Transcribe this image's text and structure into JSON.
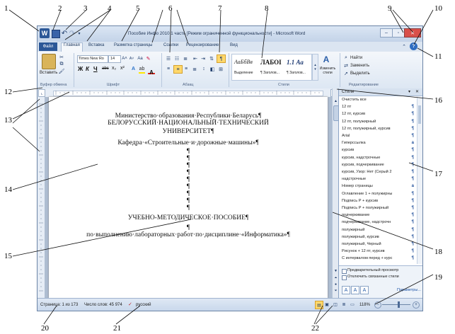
{
  "callouts": [
    "1",
    "2",
    "3",
    "4",
    "5",
    "6",
    "7",
    "8",
    "9",
    "10",
    "11",
    "12",
    "13",
    "14",
    "15",
    "16",
    "17",
    "18",
    "19",
    "20",
    "21",
    "22"
  ],
  "window": {
    "title": "Пособие Инфо 2010 1 часть [Режим ограниченной функциональности] - Microsoft Word"
  },
  "tabs": {
    "file": "Файл",
    "home": "Главная",
    "insert": "Вставка",
    "layout": "Разметка страницы",
    "refs": "Ссылки",
    "review": "Рецензирование",
    "view": "Вид"
  },
  "ribbon": {
    "paste": "Вставить",
    "font_name": "Times New Ro",
    "font_size": "14",
    "bold": "Ж",
    "italic": "К",
    "underline": "Ч",
    "strike": "abc",
    "sub": "x₂",
    "sup": "x²",
    "aa": "Aa",
    "font_color": "A",
    "style_samples": [
      {
        "sample": "АаБбВв",
        "label": "Выделение"
      },
      {
        "sample": "ЛАБОІ",
        "label": "¶ Заголов..."
      },
      {
        "sample": "1.1 Аа",
        "label": "¶ Заголов..."
      }
    ],
    "change_styles": "Изменить стили",
    "find": "Найти",
    "replace": "Заменить",
    "select": "Выделить",
    "groups": {
      "clipboard": "Буфер обмена",
      "font": "Шрифт",
      "paragraph": "Абзац",
      "styles": "Стили",
      "editing": "Редактирование"
    }
  },
  "document": {
    "lines": [
      "Министерство·образования·Республики·Беларусь¶",
      "БЕЛОРУССКИЙ·НАЦИОНАЛЬНЫЙ·ТЕХНИЧЕСКИЙ",
      "УНИВЕРСИТЕТ¶",
      "Кафедра·«Строительные·и·дорожные·машины»¶",
      "¶",
      "¶",
      "¶",
      "¶",
      "¶",
      "¶",
      "¶",
      "¶",
      "¶",
      "УЧЕБНО-МЕТОДИЧЕСКОЕ·ПОСОБИЕ¶",
      "¶",
      "по·выполнению·лабораторных·работ·по·дисциплине·«Информатика»¶"
    ]
  },
  "styles_pane": {
    "title": "Стили",
    "items": [
      {
        "label": "Очистить все",
        "mark": ""
      },
      {
        "label": "12 пт",
        "mark": "¶"
      },
      {
        "label": "12 пт, курсив",
        "mark": "¶"
      },
      {
        "label": "12 пт, полужирный",
        "mark": "¶"
      },
      {
        "label": "12 пт, полужирный, курсив",
        "mark": "¶"
      },
      {
        "label": "Arial",
        "mark": "¶"
      },
      {
        "label": "Гиперссылка",
        "mark": "a"
      },
      {
        "label": "курсив",
        "mark": "¶"
      },
      {
        "label": "курсив, надстрочные",
        "mark": "¶"
      },
      {
        "label": "курсив, подчеркивание",
        "mark": "¶"
      },
      {
        "label": "курсив, Узор: Нет (Серый 2",
        "mark": "¶"
      },
      {
        "label": "надстрочные",
        "mark": "¶"
      },
      {
        "label": "Номер страницы",
        "mark": "a"
      },
      {
        "label": "Оглавление 1 + полужирны",
        "mark": "¶"
      },
      {
        "label": "Подпись Р + курсив",
        "mark": "¶"
      },
      {
        "label": "Подпись Р + полужирный",
        "mark": "¶"
      },
      {
        "label": "подчеркивание",
        "mark": "¶"
      },
      {
        "label": "подчеркивание, надстрочн",
        "mark": "¶"
      },
      {
        "label": "полужирный",
        "mark": "¶"
      },
      {
        "label": "полужирный, курсив",
        "mark": "¶"
      },
      {
        "label": "полужирный, Черный",
        "mark": "¶"
      },
      {
        "label": "Рисунок + 12 пт, курсив",
        "mark": "¶"
      },
      {
        "label": "С интервалом перед + курс",
        "mark": "¶"
      }
    ],
    "preview": "Предварительный просмотр",
    "linked": "Отключить связанные стили",
    "params": "Параметры..."
  },
  "status": {
    "page": "Страница: 1 из 173",
    "words": "Число слов: 45 974",
    "lang": "русский",
    "zoom": "118%"
  }
}
